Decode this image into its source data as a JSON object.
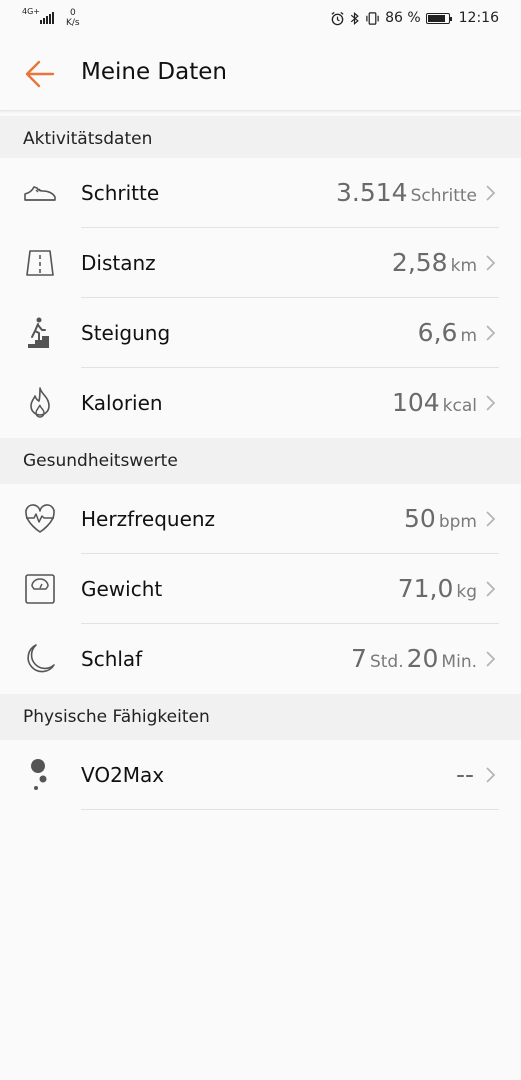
{
  "statusbar": {
    "network": "4G+",
    "speed_value": "0",
    "speed_unit": "K/s",
    "battery": "86 %",
    "battery_level": 0.86,
    "time": "12:16"
  },
  "header": {
    "title": "Meine Daten"
  },
  "colors": {
    "accent": "#e8763a"
  },
  "sections": {
    "activity": {
      "title": "Aktivitätsdaten",
      "rows": [
        {
          "icon": "shoe-icon",
          "label": "Schritte",
          "value": "3.514",
          "unit": "Schritte"
        },
        {
          "icon": "road-icon",
          "label": "Distanz",
          "value": "2,58",
          "unit": "km"
        },
        {
          "icon": "stairs-climber-icon",
          "label": "Steigung",
          "value": "6,6",
          "unit": "m"
        },
        {
          "icon": "flame-icon",
          "label": "Kalorien",
          "value": "104",
          "unit": "kcal"
        }
      ]
    },
    "health": {
      "title": "Gesundheitswerte",
      "rows": [
        {
          "icon": "heart-rate-icon",
          "label": "Herzfrequenz",
          "value": "50",
          "unit": "bpm"
        },
        {
          "icon": "scale-icon",
          "label": "Gewicht",
          "value": "71,0",
          "unit": "kg"
        },
        {
          "icon": "moon-icon",
          "label": "Schlaf",
          "value": "7",
          "unit": "Std.",
          "value2": "20",
          "unit2": "Min."
        }
      ]
    },
    "physical": {
      "title": "Physische Fähigkeiten",
      "rows": [
        {
          "icon": "vo2max-icon",
          "label": "VO2Max",
          "value": "--",
          "unit": ""
        }
      ]
    }
  }
}
